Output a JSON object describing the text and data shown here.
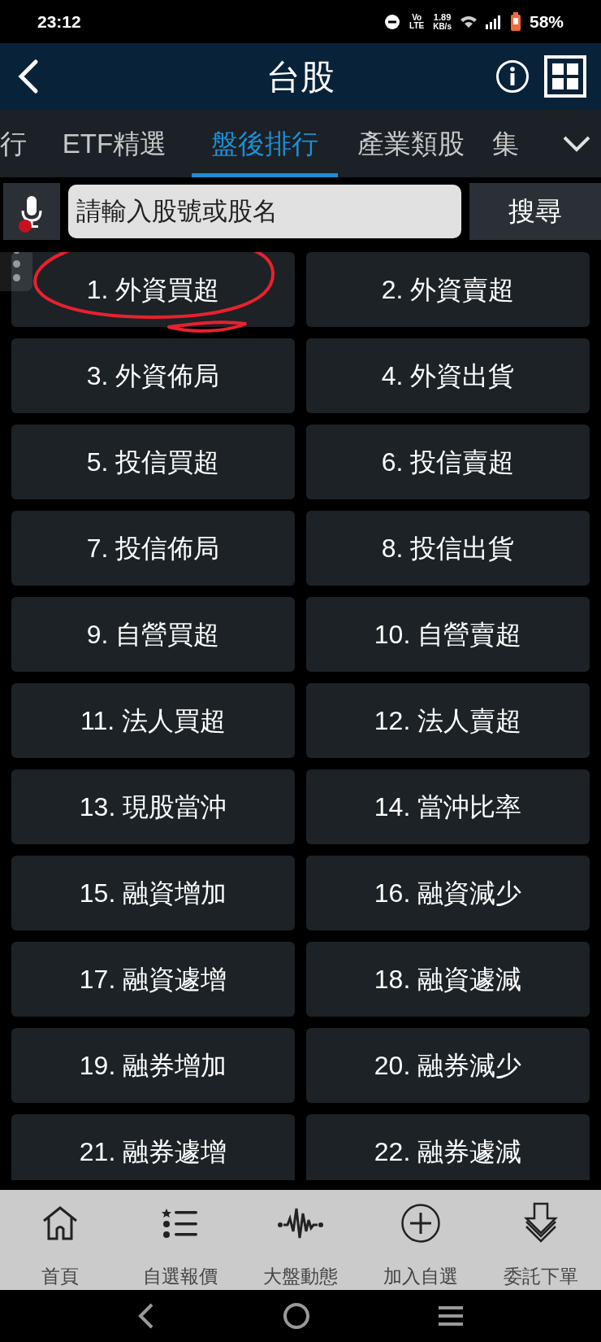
{
  "status_bar": {
    "time": "23:12",
    "net_type": "Vo LTE",
    "speed": "1.89",
    "speed_unit": "KB/s",
    "battery": "58%"
  },
  "header": {
    "title": "台股"
  },
  "tabs": [
    {
      "label": "行",
      "selected": false
    },
    {
      "label": "ETF精選",
      "selected": false
    },
    {
      "label": "盤後排行",
      "selected": true
    },
    {
      "label": "產業類股",
      "selected": false
    },
    {
      "label": "集",
      "selected": false
    }
  ],
  "search": {
    "placeholder": "請輸入股號或股名",
    "button": "搜尋"
  },
  "rankings": [
    {
      "label": "1. 外資買超",
      "circled": true
    },
    {
      "label": "2. 外資賣超",
      "circled": false
    },
    {
      "label": "3. 外資佈局",
      "circled": false
    },
    {
      "label": "4. 外資出貨",
      "circled": false
    },
    {
      "label": "5. 投信買超",
      "circled": false
    },
    {
      "label": "6. 投信賣超",
      "circled": false
    },
    {
      "label": "7. 投信佈局",
      "circled": false
    },
    {
      "label": "8. 投信出貨",
      "circled": false
    },
    {
      "label": "9. 自營買超",
      "circled": false
    },
    {
      "label": "10. 自營賣超",
      "circled": false
    },
    {
      "label": "11. 法人買超",
      "circled": false
    },
    {
      "label": "12. 法人賣超",
      "circled": false
    },
    {
      "label": "13. 現股當沖",
      "circled": false
    },
    {
      "label": "14. 當沖比率",
      "circled": false
    },
    {
      "label": "15. 融資增加",
      "circled": false
    },
    {
      "label": "16. 融資減少",
      "circled": false
    },
    {
      "label": "17. 融資遽增",
      "circled": false
    },
    {
      "label": "18. 融資遽減",
      "circled": false
    },
    {
      "label": "19. 融券增加",
      "circled": false
    },
    {
      "label": "20. 融券減少",
      "circled": false
    },
    {
      "label": "21. 融券遽增",
      "circled": false
    },
    {
      "label": "22. 融券遽減",
      "circled": false
    }
  ],
  "bottom_nav": [
    {
      "kind": "home",
      "label": "首頁"
    },
    {
      "kind": "list",
      "label": "自選報價"
    },
    {
      "kind": "pulse",
      "label": "大盤動態"
    },
    {
      "kind": "add",
      "label": "加入自選"
    },
    {
      "kind": "order",
      "label": "委託下單"
    }
  ]
}
